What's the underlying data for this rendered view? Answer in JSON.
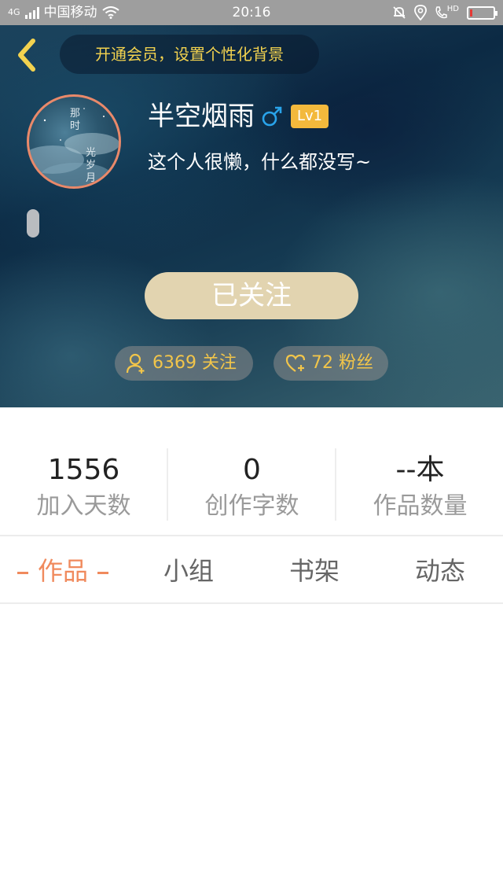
{
  "status_bar": {
    "network": "4G",
    "carrier": "中国移动",
    "time": "20:16",
    "hd_label": "HD",
    "battery_level": 0.12,
    "battery_color": "#e53935",
    "icons": [
      "signal-icon",
      "wifi-icon",
      "bell-off-icon",
      "location-icon",
      "hd-call-icon",
      "battery-icon"
    ]
  },
  "header": {
    "back_icon": "chevron-left-icon",
    "vip_banner": "开通会员，设置个性化背景",
    "avatar_text": [
      "那",
      "时",
      "光",
      "岁",
      "月"
    ],
    "username": "半空烟雨",
    "gender_icon": "male-icon",
    "gender_color": "#29a3ea",
    "level": "Lv1",
    "level_color": "#f3b93c",
    "bio": "这个人很懒，什么都没写~",
    "follow_button": "已关注",
    "following_count": "6369 关注",
    "fans_count": "72 粉丝",
    "accent": "#f2c54a"
  },
  "stats": [
    {
      "value": "1556",
      "label": "加入天数"
    },
    {
      "value": "0",
      "label": "创作字数"
    },
    {
      "value": "--本",
      "label": "作品数量"
    }
  ],
  "tabs": {
    "items": [
      "作品",
      "小组",
      "书架",
      "动态"
    ],
    "active_index": 0,
    "active_color": "#f08a5d"
  }
}
